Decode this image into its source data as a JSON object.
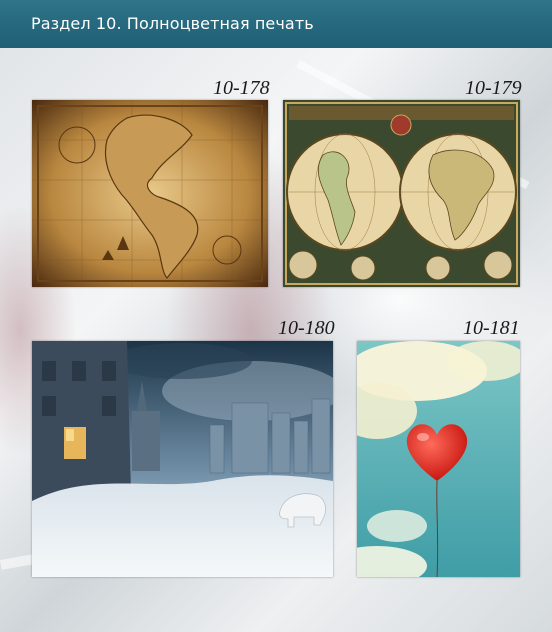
{
  "header": {
    "title": "Раздел 10. Полноцветная печать"
  },
  "items": [
    {
      "code": "10-178",
      "subject": "antique-map-americas"
    },
    {
      "code": "10-179",
      "subject": "antique-world-map"
    },
    {
      "code": "10-180",
      "subject": "frozen-city-polar-bear"
    },
    {
      "code": "10-181",
      "subject": "red-heart-balloon"
    }
  ],
  "colors": {
    "header": "#236579",
    "header_text": "#ffffff",
    "code_text": "#1a1a1a"
  }
}
